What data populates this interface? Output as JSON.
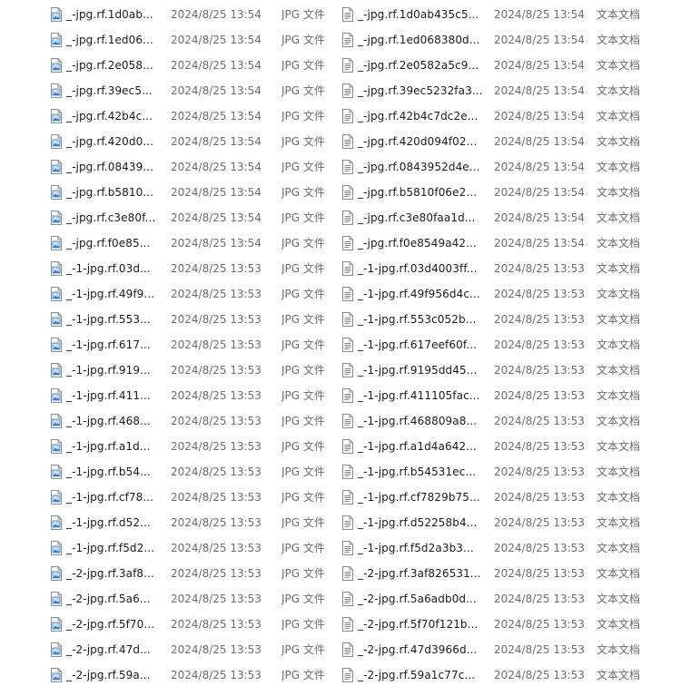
{
  "colors": {
    "text": "#1a1a1a",
    "meta": "#6d6d6d",
    "image_icon_accent": "#2d7bd4",
    "doc_icon_lines": "#7a7a7a"
  },
  "icons": {
    "jpg": "image-file-icon",
    "txt": "text-document-icon"
  },
  "left_files": [
    {
      "name": "_-jpg.rf.1d0ab...",
      "date": "2024/8/25 13:54",
      "type": "JPG 文件"
    },
    {
      "name": "_-jpg.rf.1ed06...",
      "date": "2024/8/25 13:54",
      "type": "JPG 文件"
    },
    {
      "name": "_-jpg.rf.2e058...",
      "date": "2024/8/25 13:54",
      "type": "JPG 文件"
    },
    {
      "name": "_-jpg.rf.39ec5...",
      "date": "2024/8/25 13:54",
      "type": "JPG 文件"
    },
    {
      "name": "_-jpg.rf.42b4c...",
      "date": "2024/8/25 13:54",
      "type": "JPG 文件"
    },
    {
      "name": "_-jpg.rf.420d0...",
      "date": "2024/8/25 13:54",
      "type": "JPG 文件"
    },
    {
      "name": "_-jpg.rf.08439...",
      "date": "2024/8/25 13:54",
      "type": "JPG 文件"
    },
    {
      "name": "_-jpg.rf.b5810...",
      "date": "2024/8/25 13:54",
      "type": "JPG 文件"
    },
    {
      "name": "_-jpg.rf.c3e80f...",
      "date": "2024/8/25 13:54",
      "type": "JPG 文件"
    },
    {
      "name": "_-jpg.rf.f0e85...",
      "date": "2024/8/25 13:54",
      "type": "JPG 文件"
    },
    {
      "name": "_-1-jpg.rf.03d...",
      "date": "2024/8/25 13:53",
      "type": "JPG 文件"
    },
    {
      "name": "_-1-jpg.rf.49f9...",
      "date": "2024/8/25 13:53",
      "type": "JPG 文件"
    },
    {
      "name": "_-1-jpg.rf.553...",
      "date": "2024/8/25 13:53",
      "type": "JPG 文件"
    },
    {
      "name": "_-1-jpg.rf.617...",
      "date": "2024/8/25 13:53",
      "type": "JPG 文件"
    },
    {
      "name": "_-1-jpg.rf.919...",
      "date": "2024/8/25 13:53",
      "type": "JPG 文件"
    },
    {
      "name": "_-1-jpg.rf.411...",
      "date": "2024/8/25 13:53",
      "type": "JPG 文件"
    },
    {
      "name": "_-1-jpg.rf.468...",
      "date": "2024/8/25 13:53",
      "type": "JPG 文件"
    },
    {
      "name": "_-1-jpg.rf.a1d...",
      "date": "2024/8/25 13:53",
      "type": "JPG 文件"
    },
    {
      "name": "_-1-jpg.rf.b54...",
      "date": "2024/8/25 13:53",
      "type": "JPG 文件"
    },
    {
      "name": "_-1-jpg.rf.cf78...",
      "date": "2024/8/25 13:53",
      "type": "JPG 文件"
    },
    {
      "name": "_-1-jpg.rf.d52...",
      "date": "2024/8/25 13:53",
      "type": "JPG 文件"
    },
    {
      "name": "_-1-jpg.rf.f5d2...",
      "date": "2024/8/25 13:53",
      "type": "JPG 文件"
    },
    {
      "name": "_-2-jpg.rf.3af8...",
      "date": "2024/8/25 13:53",
      "type": "JPG 文件"
    },
    {
      "name": "_-2-jpg.rf.5a6...",
      "date": "2024/8/25 13:53",
      "type": "JPG 文件"
    },
    {
      "name": "_-2-jpg.rf.5f70...",
      "date": "2024/8/25 13:53",
      "type": "JPG 文件"
    },
    {
      "name": "_-2-jpg.rf.47d...",
      "date": "2024/8/25 13:53",
      "type": "JPG 文件"
    },
    {
      "name": "_-2-jpg.rf.59a...",
      "date": "2024/8/25 13:53",
      "type": "JPG 文件"
    }
  ],
  "right_files": [
    {
      "name": "_-jpg.rf.1d0ab435c5...",
      "date": "2024/8/25 13:54",
      "type": "文本文档"
    },
    {
      "name": "_-jpg.rf.1ed068380d...",
      "date": "2024/8/25 13:54",
      "type": "文本文档"
    },
    {
      "name": "_-jpg.rf.2e0582a5c9...",
      "date": "2024/8/25 13:54",
      "type": "文本文档"
    },
    {
      "name": "_-jpg.rf.39ec5232fa3...",
      "date": "2024/8/25 13:54",
      "type": "文本文档"
    },
    {
      "name": "_-jpg.rf.42b4c7dc2e...",
      "date": "2024/8/25 13:54",
      "type": "文本文档"
    },
    {
      "name": "_-jpg.rf.420d094f02...",
      "date": "2024/8/25 13:54",
      "type": "文本文档"
    },
    {
      "name": "_-jpg.rf.0843952d4e...",
      "date": "2024/8/25 13:54",
      "type": "文本文档"
    },
    {
      "name": "_-jpg.rf.b5810f06e2...",
      "date": "2024/8/25 13:54",
      "type": "文本文档"
    },
    {
      "name": "_-jpg.rf.c3e80faa1d...",
      "date": "2024/8/25 13:54",
      "type": "文本文档"
    },
    {
      "name": "_-jpg.rf.f0e8549a42...",
      "date": "2024/8/25 13:54",
      "type": "文本文档"
    },
    {
      "name": "_-1-jpg.rf.03d4003ff...",
      "date": "2024/8/25 13:53",
      "type": "文本文档"
    },
    {
      "name": "_-1-jpg.rf.49f956d4c...",
      "date": "2024/8/25 13:53",
      "type": "文本文档"
    },
    {
      "name": "_-1-jpg.rf.553c052b...",
      "date": "2024/8/25 13:53",
      "type": "文本文档"
    },
    {
      "name": "_-1-jpg.rf.617eef60f...",
      "date": "2024/8/25 13:53",
      "type": "文本文档"
    },
    {
      "name": "_-1-jpg.rf.9195dd45...",
      "date": "2024/8/25 13:53",
      "type": "文本文档"
    },
    {
      "name": "_-1-jpg.rf.411105fac...",
      "date": "2024/8/25 13:53",
      "type": "文本文档"
    },
    {
      "name": "_-1-jpg.rf.468809a8...",
      "date": "2024/8/25 13:53",
      "type": "文本文档"
    },
    {
      "name": "_-1-jpg.rf.a1d4a642...",
      "date": "2024/8/25 13:53",
      "type": "文本文档"
    },
    {
      "name": "_-1-jpg.rf.b54531ec...",
      "date": "2024/8/25 13:53",
      "type": "文本文档"
    },
    {
      "name": "_-1-jpg.rf.cf7829b75...",
      "date": "2024/8/25 13:53",
      "type": "文本文档"
    },
    {
      "name": "_-1-jpg.rf.d52258b4...",
      "date": "2024/8/25 13:53",
      "type": "文本文档"
    },
    {
      "name": "_-1-jpg.rf.f5d2a3b3...",
      "date": "2024/8/25 13:53",
      "type": "文本文档"
    },
    {
      "name": "_-2-jpg.rf.3af826531...",
      "date": "2024/8/25 13:53",
      "type": "文本文档"
    },
    {
      "name": "_-2-jpg.rf.5a6adb0d...",
      "date": "2024/8/25 13:53",
      "type": "文本文档"
    },
    {
      "name": "_-2-jpg.rf.5f70f121b...",
      "date": "2024/8/25 13:53",
      "type": "文本文档"
    },
    {
      "name": "_-2-jpg.rf.47d3966d...",
      "date": "2024/8/25 13:53",
      "type": "文本文档"
    },
    {
      "name": "_-2-jpg.rf.59a1c77c...",
      "date": "2024/8/25 13:53",
      "type": "文本文档"
    }
  ]
}
